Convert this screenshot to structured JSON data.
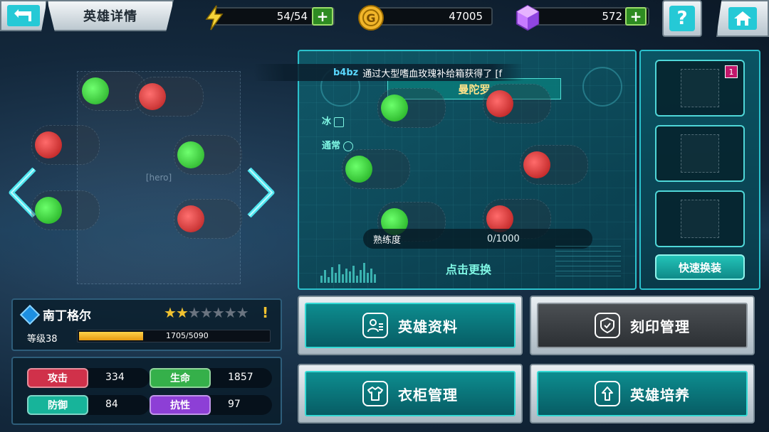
{
  "topbar": {
    "back_icon": "back-arrow-icon",
    "title": "英雄详情",
    "energy": {
      "icon": "lightning-icon",
      "value": "54/54",
      "color": "#f6d53a"
    },
    "gold": {
      "icon": "gold-coin-icon",
      "value": "47005",
      "color": "#f1b52a"
    },
    "gems": {
      "icon": "diamond-icon",
      "value": "572",
      "color": "#c77bff"
    },
    "help_label": "?",
    "home_icon": "home-icon"
  },
  "notice": {
    "user": "b4bz",
    "text": "通过大型嗜血玫瑰补给箱获得了 [f"
  },
  "weapon": {
    "name": "曼陀罗",
    "element": "冰",
    "rarity": "通常",
    "proficiency_label": "熟练度",
    "proficiency_value": "0/1000",
    "change_label": "点击更换"
  },
  "equipment": {
    "slots": [
      {
        "icon": "golden-claw-icon",
        "badge": "1"
      },
      {
        "icon": "red-armor-icon"
      },
      {
        "icon": "emblem-icon"
      }
    ],
    "quick_swap_label": "快速换装"
  },
  "hero": {
    "name": "南丁格尔",
    "stars": 2,
    "max_stars": 7,
    "warning": "!",
    "level_label": "等级38",
    "xp_text": "1705/5090",
    "xp_fraction": 0.335
  },
  "stats": [
    {
      "label": "攻击",
      "value": "334",
      "color": "#d0314a"
    },
    {
      "label": "生命",
      "value": "1857",
      "color": "#35b04a"
    },
    {
      "label": "防御",
      "value": "84",
      "color": "#17b49a"
    },
    {
      "label": "抗性",
      "value": "97",
      "color": "#8d3fd6"
    }
  ],
  "actions": [
    {
      "label": "英雄资料",
      "icon": "profile-icon",
      "style": "teal"
    },
    {
      "label": "刻印管理",
      "icon": "imprint-icon",
      "style": "dark"
    },
    {
      "label": "衣柜管理",
      "icon": "wardrobe-icon",
      "style": "teal"
    },
    {
      "label": "英雄培养",
      "icon": "upgrade-icon",
      "style": "teal"
    }
  ]
}
